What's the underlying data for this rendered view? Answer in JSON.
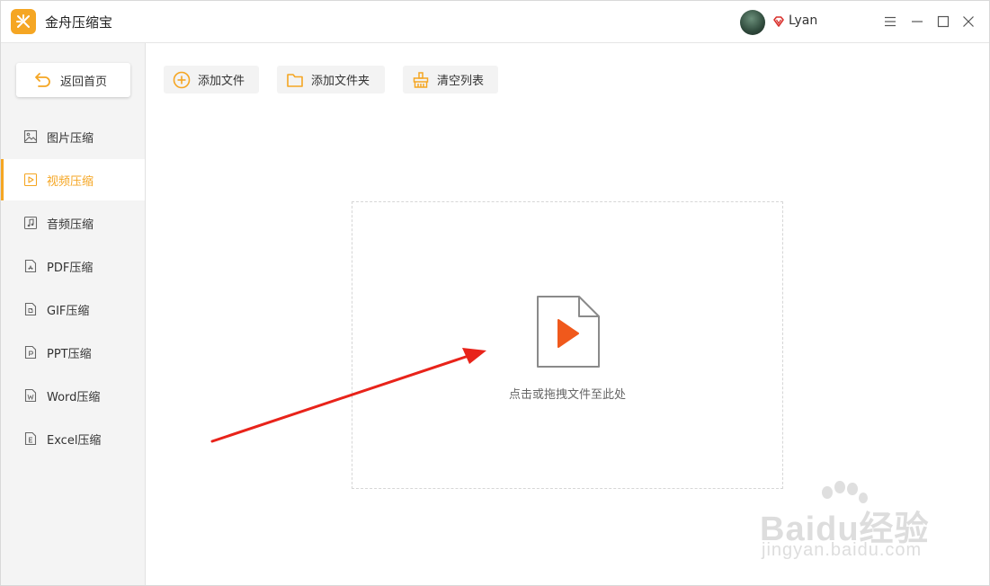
{
  "app": {
    "title": "金舟压缩宝",
    "accent": "#f5a623"
  },
  "user": {
    "name": "Lyan"
  },
  "window_controls": [
    "menu-icon",
    "minimize-icon",
    "maximize-icon",
    "close-icon"
  ],
  "sidebar": {
    "home_label": "返回首页",
    "items": [
      {
        "label": "图片压缩",
        "icon": "image-icon",
        "active": false
      },
      {
        "label": "视频压缩",
        "icon": "video-icon",
        "active": true
      },
      {
        "label": "音频压缩",
        "icon": "audio-icon",
        "active": false
      },
      {
        "label": "PDF压缩",
        "icon": "pdf-icon",
        "active": false
      },
      {
        "label": "GIF压缩",
        "icon": "gif-icon",
        "active": false
      },
      {
        "label": "PPT压缩",
        "icon": "ppt-icon",
        "active": false
      },
      {
        "label": "Word压缩",
        "icon": "word-icon",
        "active": false
      },
      {
        "label": "Excel压缩",
        "icon": "excel-icon",
        "active": false
      }
    ]
  },
  "toolbar": {
    "add_file": "添加文件",
    "add_folder": "添加文件夹",
    "clear_list": "清空列表"
  },
  "dropzone": {
    "hint": "点击或拖拽文件至此处",
    "icon": "video-file-icon"
  },
  "annotation": {
    "color": "#e8231a"
  },
  "watermark": {
    "brand": "Baidu经验",
    "url": "jingyan.baidu.com"
  }
}
